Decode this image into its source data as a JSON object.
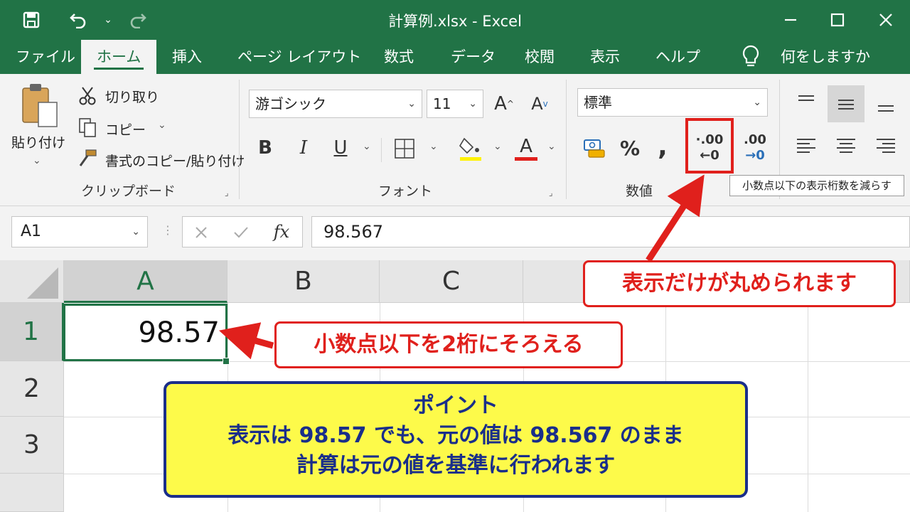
{
  "titlebar": {
    "title": "計算例.xlsx  -  Excel"
  },
  "tabs": [
    {
      "label": "ファイル"
    },
    {
      "label": "ホーム"
    },
    {
      "label": "挿入"
    },
    {
      "label": "ページ レイアウト"
    },
    {
      "label": "数式"
    },
    {
      "label": "データ"
    },
    {
      "label": "校閲"
    },
    {
      "label": "表示"
    },
    {
      "label": "ヘルプ"
    }
  ],
  "tell_me": "何をしますか",
  "clipboard": {
    "paste": "貼り付け",
    "cut": "切り取り",
    "copy": "コピー",
    "format_painter": "書式のコピー/貼り付け",
    "group_label": "クリップボード"
  },
  "font": {
    "font_name": "游ゴシック",
    "font_size": "11",
    "bold": "B",
    "italic": "I",
    "underline": "U",
    "font_color_letter": "A",
    "group_label": "フォント"
  },
  "number": {
    "format": "標準",
    "percent": "%",
    "comma": ",",
    "decrease_top": "·.00",
    "decrease_bottom": "←0",
    "increase_top": ".00",
    "increase_bottom": "→0",
    "group_label": "数値"
  },
  "tooltip": "小数点以下の表示桁数を減らす",
  "formula_bar": {
    "name_box": "A1",
    "fx": "fx",
    "value": "98.567"
  },
  "grid": {
    "columns": [
      "A",
      "B",
      "C"
    ],
    "rows": [
      "1",
      "2",
      "3"
    ],
    "a1_value": "98.57"
  },
  "callouts": {
    "display_rounded": "表示だけが丸められます",
    "two_decimals": "小数点以下を2桁にそろえる"
  },
  "point": {
    "heading": "ポイント",
    "line1": "表示は 98.57 でも、元の値は 98.567 のまま",
    "line2": "計算は元の値を基準に行われます"
  },
  "colors": {
    "excel_green": "#217346",
    "callout_red": "#e0201c",
    "point_yellow": "#fdfa4a",
    "point_navy": "#1a2e8a"
  }
}
